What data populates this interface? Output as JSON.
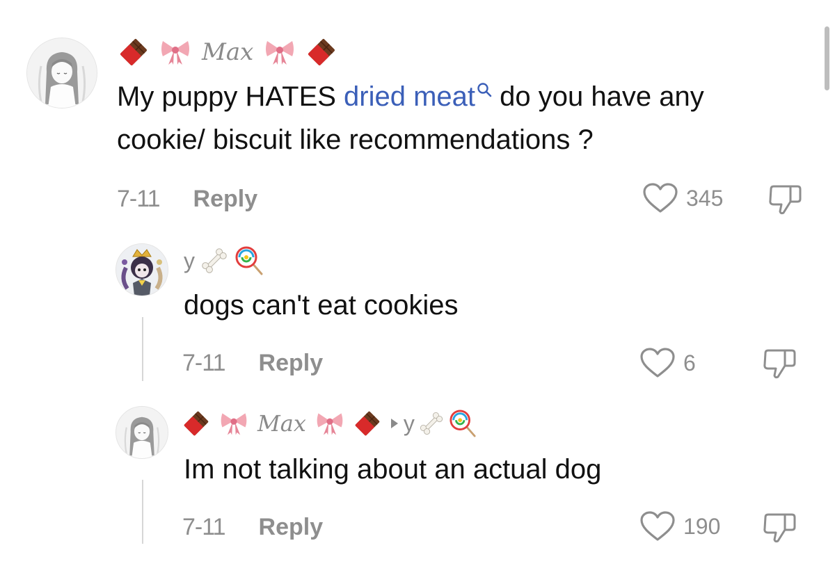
{
  "comments": [
    {
      "username": "Max",
      "text_before": "My puppy HATES ",
      "link": "dried meat",
      "text_after": " do you have any",
      "text_line2": "cookie/ biscuit like recommendations ?",
      "date": "7-11",
      "reply_label": "Reply",
      "likes": "345"
    },
    {
      "username": "y",
      "text": "dogs can't eat cookies",
      "date": "7-11",
      "reply_label": "Reply",
      "likes": "6"
    },
    {
      "username": "Max",
      "reply_to": "y",
      "text": "Im not talking about an actual dog",
      "date": "7-11",
      "reply_label": "Reply",
      "likes": "190"
    }
  ],
  "colors": {
    "link": "#3b5fb8",
    "meta_gray": "#8e8e8e",
    "username_gray": "#8a8a8a"
  },
  "icons": {
    "chocolate": "chocolate-bar-icon",
    "bow": "ribbon-bow-icon",
    "bone": "bone-icon",
    "lollipop": "lollipop-icon",
    "search": "search-icon",
    "heart": "heart-outline-icon",
    "dislike": "thumbs-down-icon",
    "reply_arrow": "reply-arrow-icon"
  }
}
